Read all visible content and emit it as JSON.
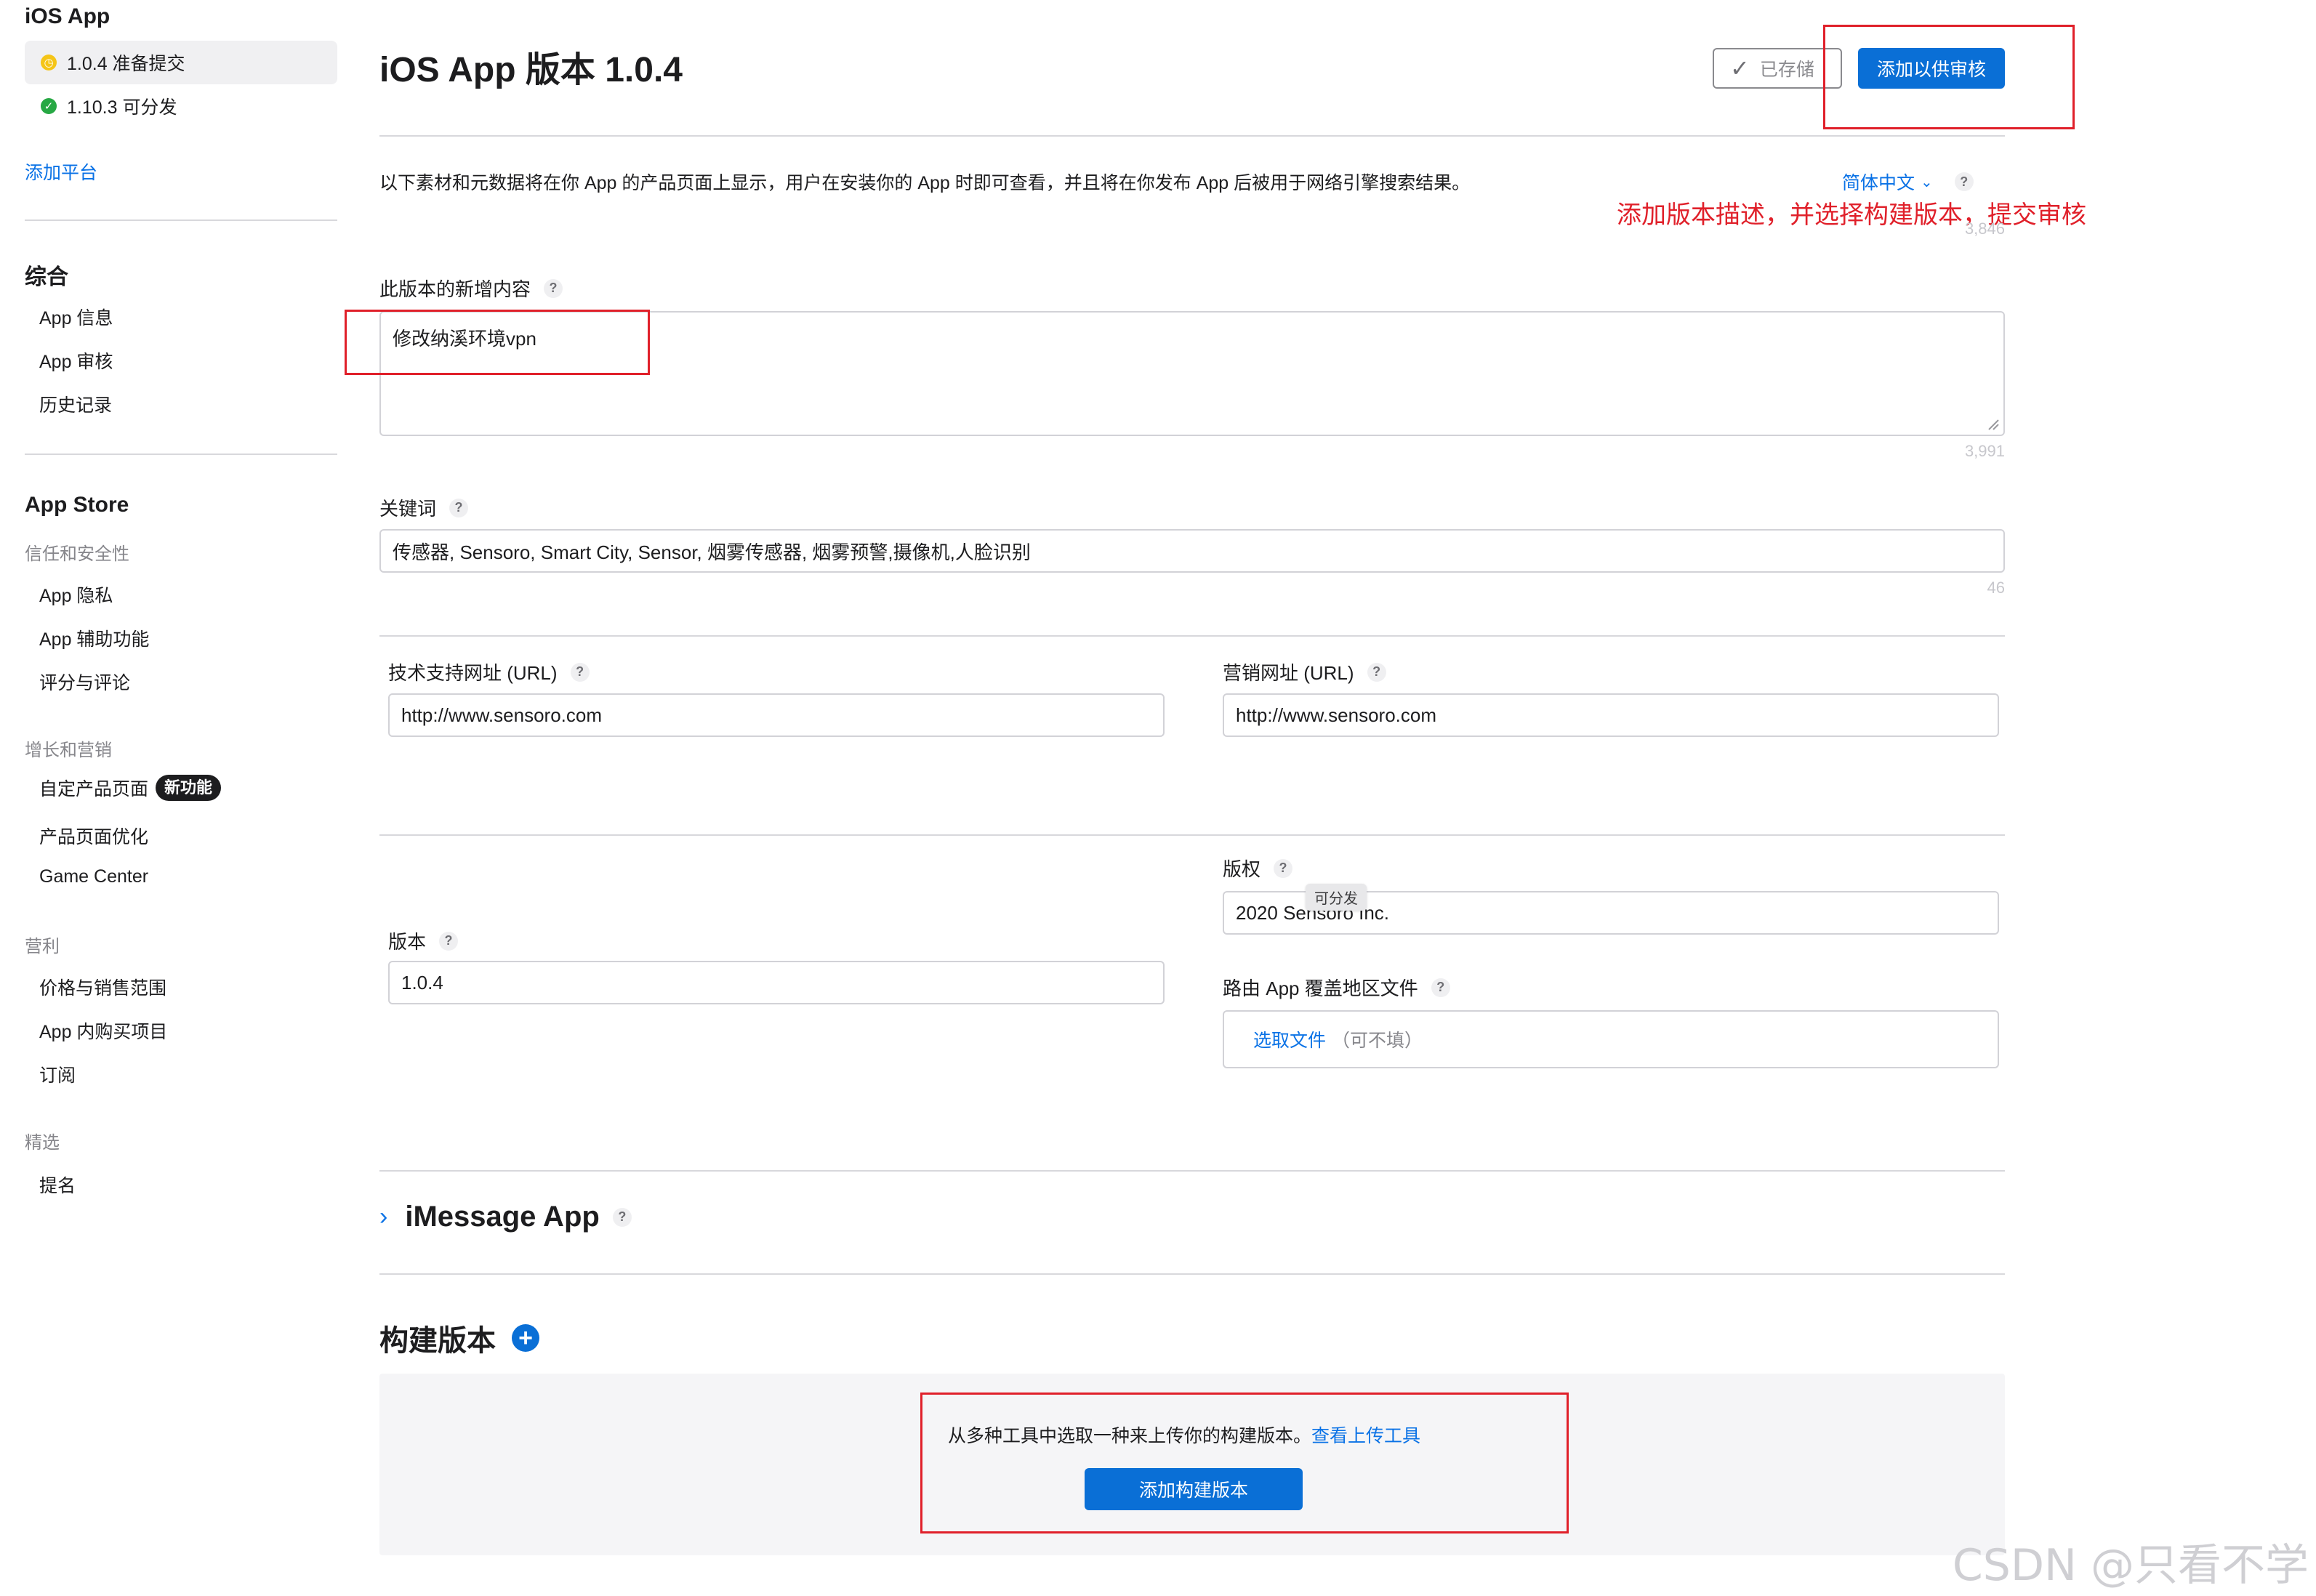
{
  "sidebar": {
    "app_title": "iOS App",
    "versions": [
      {
        "label": "1.0.4 准备提交",
        "status": "yellow"
      },
      {
        "label": "1.10.3 可分发",
        "status": "green"
      }
    ],
    "add_platform": "添加平台",
    "general": {
      "title": "综合",
      "items": [
        "App 信息",
        "App 审核",
        "历史记录"
      ]
    },
    "appstore": {
      "title": "App Store",
      "trust_title": "信任和安全性",
      "trust_items": [
        "App 隐私",
        "App 辅助功能",
        "评分与评论"
      ],
      "growth_title": "增长和营销",
      "growth_items": [
        "自定产品页面",
        "产品页面优化",
        "Game Center"
      ],
      "new_badge": "新功能",
      "monetize_title": "营利",
      "monetize_items": [
        "价格与销售范围",
        "App 内购买项目",
        "订阅"
      ],
      "featured_title": "精选",
      "featured_items": [
        "提名"
      ]
    }
  },
  "header": {
    "title": "iOS App 版本 1.0.4",
    "saved_label": "已存储",
    "submit_label": "添加以供审核"
  },
  "main": {
    "description": "以下素材和元数据将在你 App 的产品页面上显示，用户在安装你的 App 时即可查看，并且将在你发布 App 后被用于网络引擎搜索结果。",
    "language": "简体中文",
    "annotation": "添加版本描述，并选择构建版本，提交审核",
    "top_count": "3,846",
    "whats_new": {
      "label": "此版本的新增内容",
      "value": "修改纳溪环境vpn",
      "count": "3,991"
    },
    "keywords": {
      "label": "关键词",
      "value": "传感器, Sensoro, Smart City, Sensor, 烟雾传感器, 烟雾预警,摄像机,人脸识别",
      "count": "46"
    },
    "support_url": {
      "label": "技术支持网址 (URL)",
      "value": "http://www.sensoro.com"
    },
    "marketing_url": {
      "label": "营销网址 (URL)",
      "value": "http://www.sensoro.com"
    },
    "copyright": {
      "label": "版权",
      "value": "2020 Sensoro Inc.",
      "tooltip": "可分发"
    },
    "version": {
      "label": "版本",
      "value": "1.0.4"
    },
    "routing": {
      "label": "路由 App 覆盖地区文件",
      "choose": "选取文件",
      "optional": "（可不填）"
    },
    "imessage": {
      "title": "iMessage App"
    },
    "build": {
      "title": "构建版本",
      "hint": "从多种工具中选取一种来上传你的构建版本。",
      "hint_link": "查看上传工具",
      "add_label": "添加构建版本"
    }
  },
  "watermark": "CSDN @只看不学",
  "colors": {
    "accent": "#0a6fd6",
    "annotation": "#e0202a"
  }
}
